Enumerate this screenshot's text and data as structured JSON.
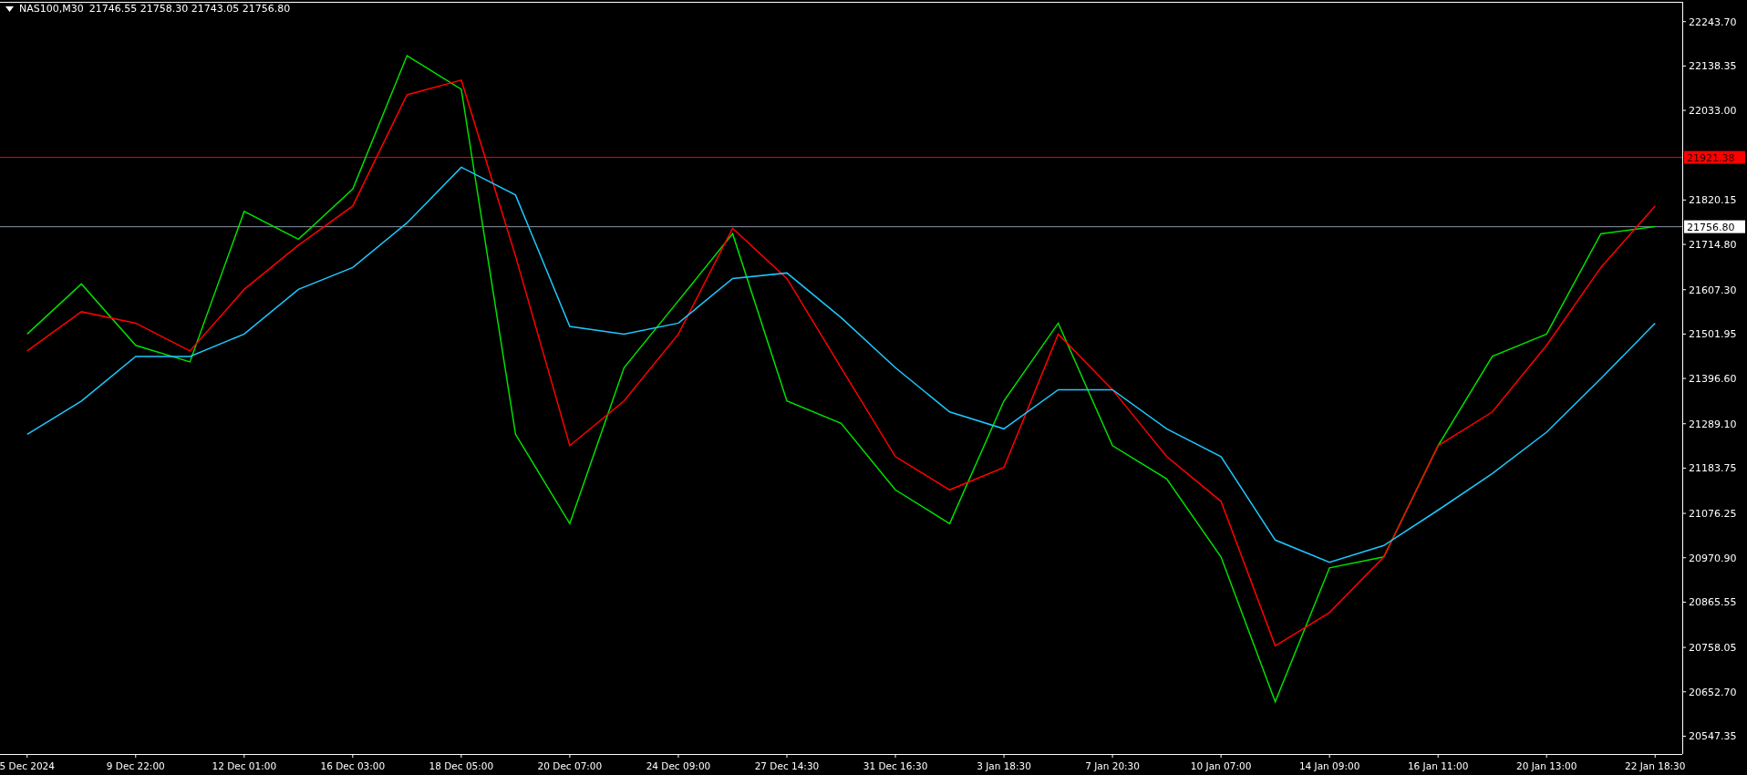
{
  "header": {
    "symbol": "NAS100,M30",
    "ohlc": "21746.55 21758.30 21743.05 21756.80"
  },
  "chart": {
    "chart_data": {
      "type": "line",
      "ylim": [
        20505,
        22295
      ],
      "categories": [
        "5 Dec 2024",
        null,
        "9 Dec 22:00",
        null,
        "12 Dec 01:00",
        null,
        "16 Dec 03:00",
        null,
        "18 Dec 05:00",
        null,
        "20 Dec 07:00",
        null,
        "24 Dec 09:00",
        null,
        "27 Dec 14:30",
        null,
        "31 Dec 16:30",
        null,
        "3 Jan 18:30",
        null,
        "7 Jan 20:30",
        null,
        "10 Jan 07:00",
        null,
        "14 Jan 09:00",
        null,
        "16 Jan 11:00",
        null,
        "20 Jan 13:00",
        null,
        "22 Jan 18:30"
      ],
      "series": [
        {
          "color": "#00e000",
          "values": [
            21502,
            21621,
            21475,
            21436,
            21793,
            21727,
            21846,
            22163,
            22083,
            21264,
            21052,
            21422,
            21581,
            21740,
            21343,
            21290,
            21132,
            21052,
            21343,
            21528,
            21237,
            21158,
            20973,
            20629,
            20947,
            20973,
            21237,
            21449,
            21502,
            21740,
            21757
          ]
        },
        {
          "color": "#ff0000",
          "values": [
            21462,
            21555,
            21528,
            21462,
            21608,
            21713,
            21806,
            22070,
            22105,
            21687,
            21237,
            21343,
            21502,
            21753,
            21634,
            21422,
            21211,
            21132,
            21185,
            21502,
            21370,
            21211,
            21105,
            20762,
            20841,
            20973,
            21237,
            21317,
            21475,
            21660,
            21806
          ]
        },
        {
          "color": "#1ec8ff",
          "values": [
            21264,
            21343,
            21449,
            21449,
            21502,
            21608,
            21660,
            21766,
            21898,
            21832,
            21520,
            21502,
            21528,
            21634,
            21647,
            21541,
            21422,
            21317,
            21277,
            21370,
            21370,
            21277,
            21211,
            21013,
            20960,
            21000,
            21084,
            21171,
            21269,
            21396,
            21528
          ]
        }
      ],
      "yticks": [
        {
          "value": 22243.7,
          "label": "22243.70"
        },
        {
          "value": 22138.35,
          "label": "22138.35"
        },
        {
          "value": 22033,
          "label": "22033.00"
        },
        {
          "value": 21820.15,
          "label": "21820.15"
        },
        {
          "value": 21714.8,
          "label": "21714.80"
        },
        {
          "value": 21607.3,
          "label": "21607.30"
        },
        {
          "value": 21501.95,
          "label": "21501.95"
        },
        {
          "value": 21396.6,
          "label": "21396.60"
        },
        {
          "value": 21289.1,
          "label": "21289.10"
        },
        {
          "value": 21183.75,
          "label": "21183.75"
        },
        {
          "value": 21076.25,
          "label": "21076.25"
        },
        {
          "value": 20970.9,
          "label": "20970.90"
        },
        {
          "value": 20865.55,
          "label": "20865.55"
        },
        {
          "value": 20758.05,
          "label": "20758.05"
        },
        {
          "value": 20652.7,
          "label": "20652.70"
        },
        {
          "value": 20547.35,
          "label": "20547.35"
        }
      ],
      "ref_lines": [
        {
          "axis": "y",
          "value": 21921.38,
          "label": "21921.38",
          "color": "#ff0000"
        },
        {
          "axis": "y",
          "value": 21756.8,
          "label": "21756.80",
          "color": "#8a94a6"
        }
      ]
    }
  }
}
